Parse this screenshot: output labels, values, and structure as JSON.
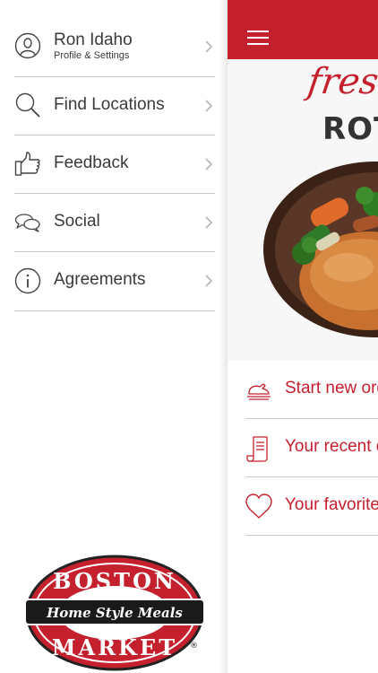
{
  "sidebar": {
    "profile": {
      "name": "Ron Idaho",
      "subtitle": "Profile & Settings",
      "icon": "person-icon"
    },
    "items": [
      {
        "label": "Find Locations",
        "icon": "search-icon"
      },
      {
        "label": "Feedback",
        "icon": "thumbs-up-icon"
      },
      {
        "label": "Social",
        "icon": "chat-bubbles-icon"
      },
      {
        "label": "Agreements",
        "icon": "info-icon"
      }
    ],
    "logo": {
      "top_text": "BOSTON",
      "banner_text": "Home Style Meals",
      "bottom_text": "MARKET",
      "mark": "®"
    }
  },
  "main": {
    "hero": {
      "line1": "fresh",
      "line2": "ROTI"
    },
    "actions": [
      {
        "label": "Start new order",
        "icon": "turkey-icon"
      },
      {
        "label": "Your recent orders",
        "icon": "receipt-icon"
      },
      {
        "label": "Your favorites",
        "icon": "heart-icon"
      }
    ]
  },
  "colors": {
    "brand_red": "#c5202e",
    "text_dark": "#3a3a3a",
    "divider": "#c9c9c9"
  }
}
